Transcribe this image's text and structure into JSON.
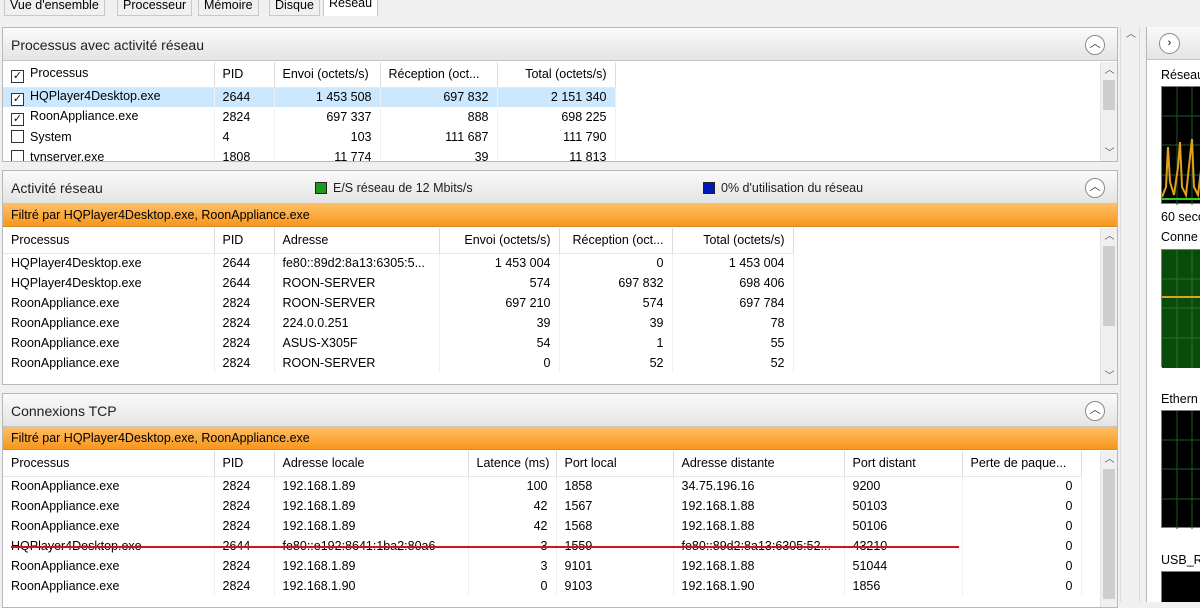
{
  "tabs": [
    "Vue d'ensemble",
    "Processeur",
    "Mémoire",
    "Disque",
    "Réseau"
  ],
  "active_tab": "Réseau",
  "proc_section": {
    "title": "Processus avec activité réseau",
    "columns": [
      "Processus",
      "PID",
      "Envoi (octets/s)",
      "Réception (oct...",
      "Total (octets/s)"
    ],
    "rows": [
      {
        "name": "HQPlayer4Desktop.exe",
        "pid": "2644",
        "send": "1 453 508",
        "recv": "697 832",
        "total": "2 151 340",
        "checked": true,
        "selected": true
      },
      {
        "name": "RoonAppliance.exe",
        "pid": "2824",
        "send": "697 337",
        "recv": "888",
        "total": "698 225",
        "checked": true,
        "selected": false
      },
      {
        "name": "System",
        "pid": "4",
        "send": "103",
        "recv": "111 687",
        "total": "111 790",
        "checked": false,
        "selected": false
      },
      {
        "name": "tvnserver.exe",
        "pid": "1808",
        "send": "11 774",
        "recv": "39",
        "total": "11 813",
        "checked": false,
        "selected": false
      }
    ]
  },
  "activity_section": {
    "title": "Activité réseau",
    "legend_io": "E/S réseau de 12 Mbits/s",
    "legend_util": "0% d'utilisation du réseau",
    "legend_io_color": "#1a9a1a",
    "legend_util_color": "#0018b4",
    "filter": "Filtré par HQPlayer4Desktop.exe, RoonAppliance.exe",
    "columns": [
      "Processus",
      "PID",
      "Adresse",
      "Envoi (octets/s)",
      "Réception (oct...",
      "Total (octets/s)"
    ],
    "rows": [
      [
        "HQPlayer4Desktop.exe",
        "2644",
        "fe80::89d2:8a13:6305:5...",
        "1 453 004",
        "0",
        "1 453 004"
      ],
      [
        "HQPlayer4Desktop.exe",
        "2644",
        "ROON-SERVER",
        "574",
        "697 832",
        "698 406"
      ],
      [
        "RoonAppliance.exe",
        "2824",
        "ROON-SERVER",
        "697 210",
        "574",
        "697 784"
      ],
      [
        "RoonAppliance.exe",
        "2824",
        "224.0.0.251",
        "39",
        "39",
        "78"
      ],
      [
        "RoonAppliance.exe",
        "2824",
        "ASUS-X305F",
        "54",
        "1",
        "55"
      ],
      [
        "RoonAppliance.exe",
        "2824",
        "ROON-SERVER",
        "0",
        "52",
        "52"
      ]
    ]
  },
  "tcp_section": {
    "title": "Connexions TCP",
    "filter": "Filtré par HQPlayer4Desktop.exe, RoonAppliance.exe",
    "columns": [
      "Processus",
      "PID",
      "Adresse locale",
      "Latence (ms)",
      "Port local",
      "Adresse distante",
      "Port distant",
      "Perte de paque..."
    ],
    "rows": [
      [
        "RoonAppliance.exe",
        "2824",
        "192.168.1.89",
        "100",
        "1858",
        "34.75.196.16",
        "9200",
        "0"
      ],
      [
        "RoonAppliance.exe",
        "2824",
        "192.168.1.89",
        "42",
        "1567",
        "192.168.1.88",
        "50103",
        "0"
      ],
      [
        "RoonAppliance.exe",
        "2824",
        "192.168.1.89",
        "42",
        "1568",
        "192.168.1.88",
        "50106",
        "0"
      ],
      [
        "HQPlayer4Desktop.exe",
        "2644",
        "fe80::e192:8641:1ba2:80a6",
        "3",
        "1559",
        "fe80::89d2:8a13:6305:52...",
        "43210",
        "0"
      ],
      [
        "RoonAppliance.exe",
        "2824",
        "192.168.1.89",
        "3",
        "9101",
        "192.168.1.88",
        "51044",
        "0"
      ],
      [
        "RoonAppliance.exe",
        "2824",
        "192.168.1.90",
        "0",
        "9103",
        "192.168.1.90",
        "1856",
        "0"
      ]
    ]
  },
  "right_pane": {
    "label_network": "Réseau",
    "label_60s": "60 seco",
    "label_conn": "Conne",
    "label_ethernet": "Ethern",
    "label_usb": "USB_R"
  }
}
